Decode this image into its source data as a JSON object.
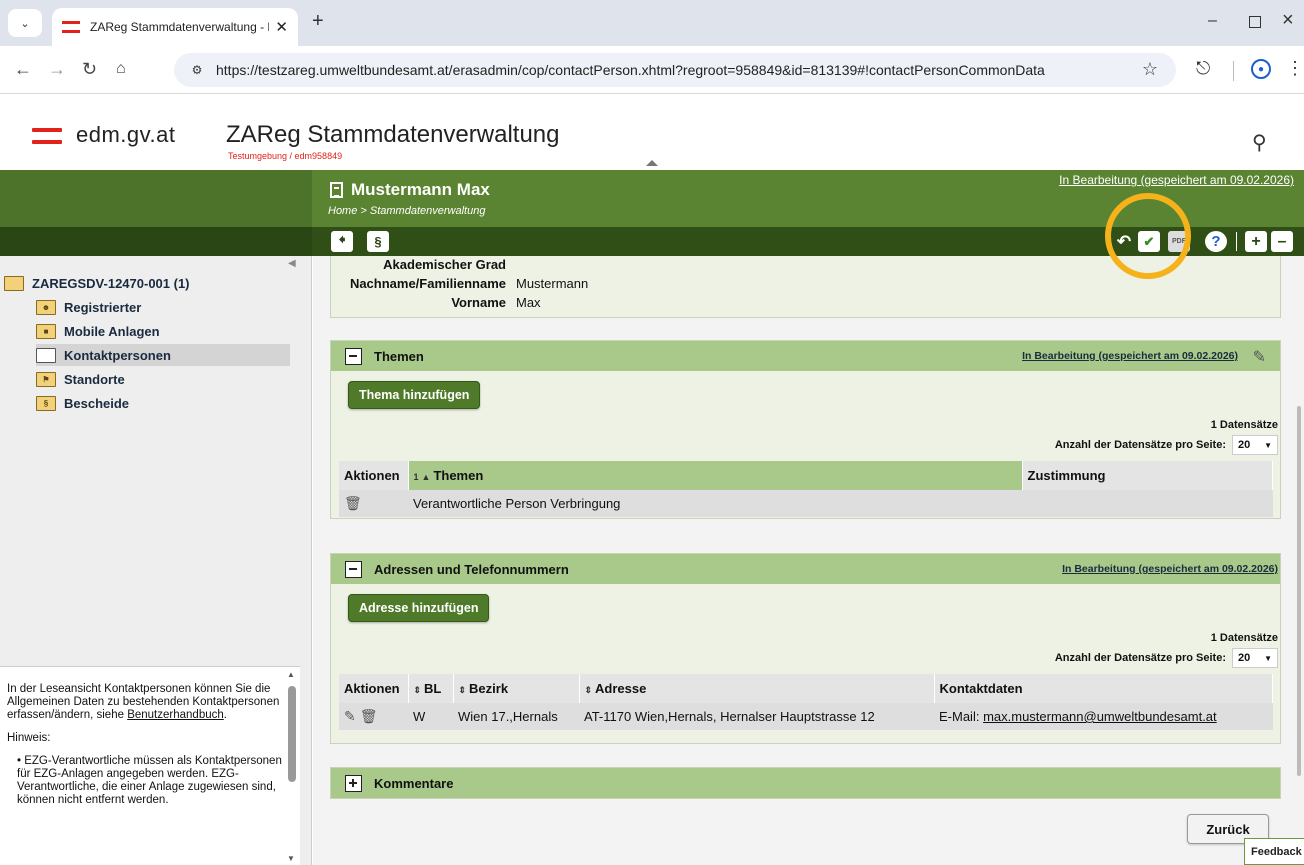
{
  "browser": {
    "tab_title": "ZAReg Stammdatenverwaltung - Mus",
    "url": "https://testzareg.umweltbundesamt.at/erasadmin/cop/contactPerson.xhtml?regroot=958849&id=813139#!contactPersonCommonData",
    "new_tab_icon": "+",
    "minimize_icon": "–",
    "close_icon": "×"
  },
  "header": {
    "logo_text": "edm.gv.at",
    "app_title": "ZAReg Stammdatenverwaltung",
    "env_label": "Testumgebung / edm958849"
  },
  "titlebar": {
    "heading": "Mustermann Max",
    "breadcrumb": "Home > Stammdatenverwaltung",
    "status": "In Bearbeitung (gespeichert am 09.02.2026)"
  },
  "toolbar": {
    "back_icon": "back-arrow",
    "law_icon": "§",
    "undo_icon": "undo",
    "save_icon": "check-document",
    "pdf_icon": "PDF",
    "help_icon": "?",
    "expand_icon": "+",
    "collapse_icon": "–",
    "highlight_color": "#f6b21a"
  },
  "sidebar": {
    "root": "ZAREGSDV-12470-001 (1)",
    "items": [
      {
        "label": "Registrierter",
        "icon": "user-folder"
      },
      {
        "label": "Mobile Anlagen",
        "icon": "truck-folder"
      },
      {
        "label": "Kontaktpersonen",
        "icon": "empty-folder"
      },
      {
        "label": "Standorte",
        "icon": "pin-folder"
      },
      {
        "label": "Bescheide",
        "icon": "paragraph-folder"
      }
    ],
    "help_text": "In der Leseansicht Kontaktpersonen können Sie die Allgemeinen Daten zu bestehenden Kontaktpersonen erfassen/ändern, siehe",
    "help_link": "Benutzerhandbuch",
    "help_link_suffix": ".",
    "hint_label": "Hinweis:",
    "hint_item": "EZG-Verantwortliche müssen als Kontaktpersonen für EZG-Anlagen angegeben werden. EZG-Verantwortliche, die einer Anlage zugewiesen sind, können nicht entfernt werden."
  },
  "person": {
    "grad_label": "Akademischer Grad",
    "grad_value": "",
    "nachname_label": "Nachname/Familienname",
    "nachname_value": "Mustermann",
    "vorname_label": "Vorname",
    "vorname_value": "Max"
  },
  "themen": {
    "title": "Themen",
    "status": "In Bearbeitung (gespeichert am 09.02.2026)",
    "add_button": "Thema hinzufügen",
    "count": "1 Datensätze",
    "perpage_label": "Anzahl der Datensätze pro Seite:",
    "perpage_value": "20",
    "columns": [
      "Aktionen",
      "Themen",
      "Zustimmung"
    ],
    "sort_index": "1",
    "rows": [
      {
        "thema": "Verantwortliche Person Verbringung",
        "zustimmung": ""
      }
    ]
  },
  "adressen": {
    "title": "Adressen und Telefonnummern",
    "status": "In Bearbeitung (gespeichert am 09.02.2026)",
    "add_button": "Adresse hinzufügen",
    "count": "1 Datensätze",
    "perpage_label": "Anzahl der Datensätze pro Seite:",
    "perpage_value": "20",
    "columns": [
      "Aktionen",
      "BL",
      "Bezirk",
      "Adresse",
      "Kontaktdaten"
    ],
    "rows": [
      {
        "bl": "W",
        "bezirk": "Wien 17.,Hernals",
        "adresse": "AT-1170 Wien,Hernals, Hernalser Hauptstrasse 12",
        "kontakt_prefix": "E-Mail:",
        "kontakt_email": "max.mustermann@umweltbundesamt.at"
      }
    ]
  },
  "kommentare": {
    "title": "Kommentare"
  },
  "footer": {
    "back_button": "Zurück",
    "feedback": "Feedback"
  }
}
